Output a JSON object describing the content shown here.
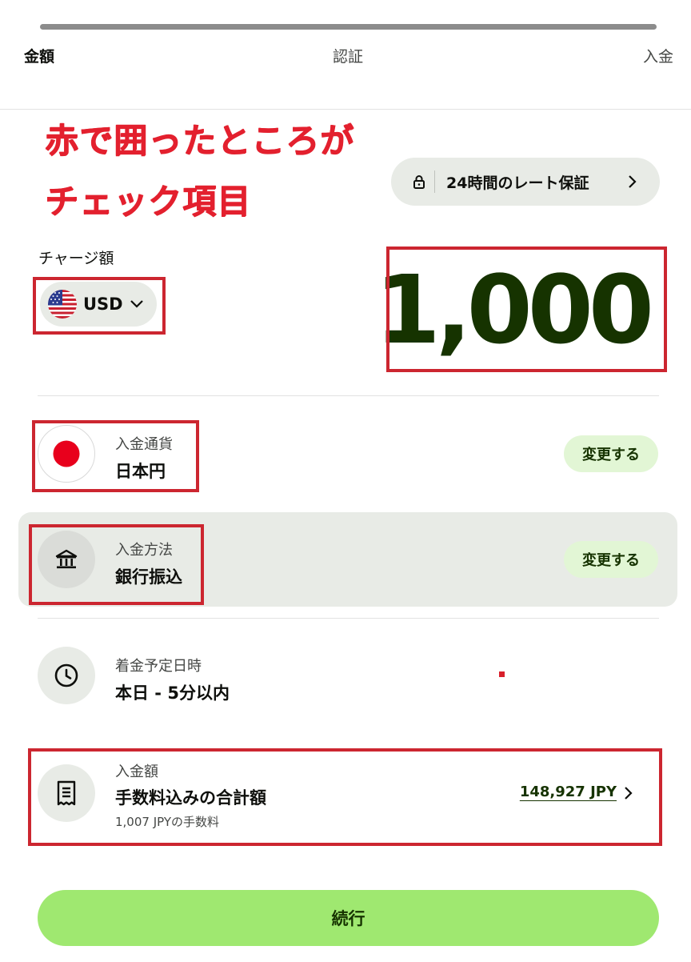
{
  "steps": {
    "amount": "金額",
    "verification": "認証",
    "deposit": "入金"
  },
  "annotation": {
    "line1": "赤で囲ったところが",
    "line2": "チェック項目"
  },
  "rate_guarantee": {
    "label": "24時間のレート保証",
    "icon": "lock-icon"
  },
  "charge": {
    "label": "チャージ額",
    "currency": "USD",
    "amount": "1,000"
  },
  "deposit_currency": {
    "label": "入金通貨",
    "value": "日本円",
    "change": "変更する"
  },
  "deposit_method": {
    "label": "入金方法",
    "value": "銀行振込",
    "change": "変更する"
  },
  "arrival": {
    "label": "着金予定日時",
    "value": "本日 - 5分以内"
  },
  "deposit_amount": {
    "label": "入金額",
    "value": "手数料込みの合計額",
    "total": "148,927 JPY",
    "fee_note": "1,007 JPYの手数料"
  },
  "continue_label": "続行",
  "colors": {
    "brand_green": "#9fe870",
    "dark_green": "#163300",
    "annotation_red": "#e3202e",
    "pill_gray": "#e8ebe6"
  }
}
